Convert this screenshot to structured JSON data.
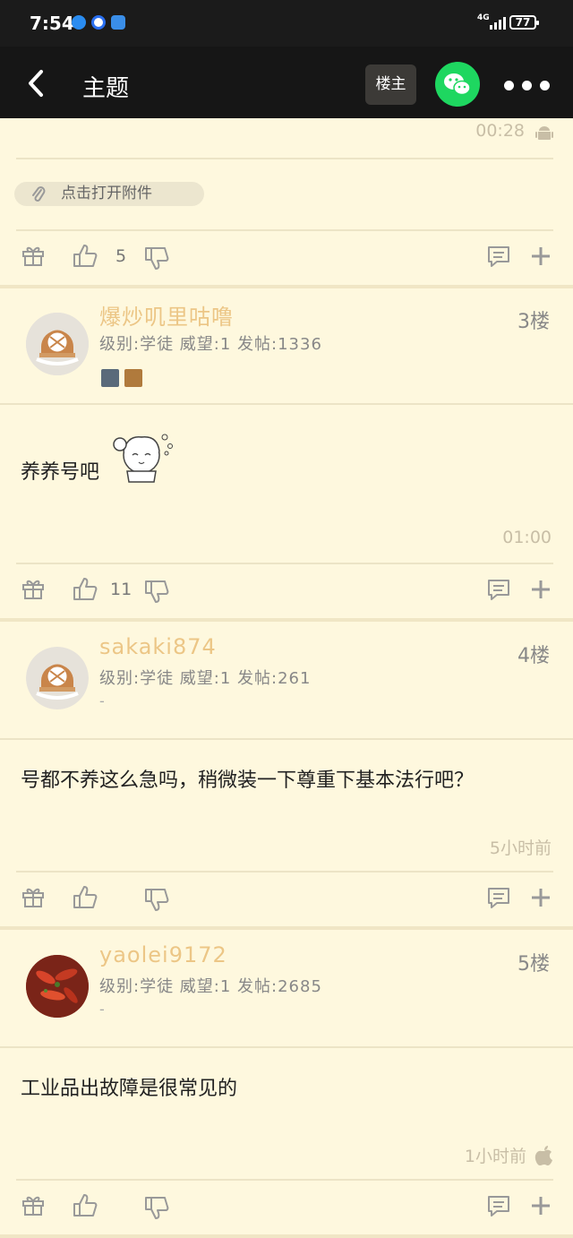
{
  "status_bar": {
    "time": "7:54",
    "network": "4G",
    "battery": "77"
  },
  "nav": {
    "title": "主题",
    "louzhu_label": "楼主"
  },
  "top_post": {
    "time": "00:28",
    "attachment_label": "点击打开附件",
    "likes": "5"
  },
  "posts": [
    {
      "username": "爆炒叽里咕噜",
      "level": "级别:学徒  威望:1  发帖:1336",
      "floor": "3楼",
      "content": "养养号吧",
      "time": "01:00",
      "likes": "11"
    },
    {
      "username": "sakaki874",
      "level": "级别:学徒  威望:1  发帖:261",
      "floor": "4楼",
      "signature": "-",
      "content": "号都不养这么急吗，稍微装一下尊重下基本法行吧？",
      "time": "5小时前",
      "likes": ""
    },
    {
      "username": "yaolei9172",
      "level": "级别:学徒  威望:1  发帖:2685",
      "floor": "5楼",
      "signature": "-",
      "content": "工业品出故障是很常见的",
      "time": "1小时前",
      "likes": ""
    }
  ],
  "colors": {
    "username": "#ecc686",
    "background": "#fef8de",
    "header": "#161616",
    "wechat": "#1ed760"
  }
}
